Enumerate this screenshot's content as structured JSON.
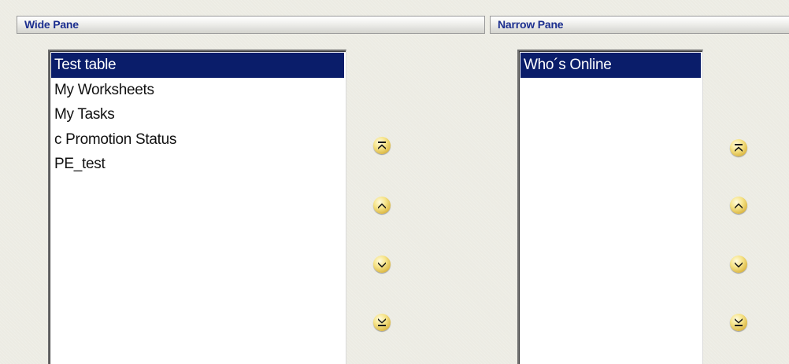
{
  "wide_pane": {
    "title": "Wide Pane",
    "items": [
      {
        "label": "Test table",
        "selected": true
      },
      {
        "label": "My Worksheets",
        "selected": false
      },
      {
        "label": "My Tasks",
        "selected": false
      },
      {
        "label": "c Promotion Status",
        "selected": false
      },
      {
        "label": "PE_test",
        "selected": false
      }
    ]
  },
  "narrow_pane": {
    "title": "Narrow Pane",
    "items": [
      {
        "label": "Who´s Online",
        "selected": true
      }
    ]
  },
  "controls": {
    "buttons": [
      "move-to-top-icon",
      "move-up-icon",
      "move-down-icon",
      "move-to-bottom-icon"
    ]
  },
  "colors": {
    "header_text": "#1c2f8f",
    "selection_bg": "#0a1d6a",
    "button_gold": "#f0d670"
  }
}
